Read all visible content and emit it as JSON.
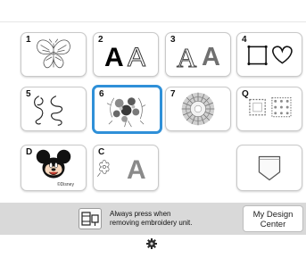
{
  "tiles": [
    {
      "id": "1",
      "label": "1",
      "kind": "butterfly"
    },
    {
      "id": "2",
      "label": "2",
      "kind": "font-aa"
    },
    {
      "id": "3",
      "label": "3",
      "kind": "font-aa-outline"
    },
    {
      "id": "4",
      "label": "4",
      "kind": "frame-heart"
    },
    {
      "id": "5",
      "label": "5",
      "kind": "scroll-flourish"
    },
    {
      "id": "6",
      "label": "6",
      "kind": "flower-bouquet",
      "selected": true
    },
    {
      "id": "7",
      "label": "7",
      "kind": "circle-pattern"
    },
    {
      "id": "Q",
      "label": "Q",
      "kind": "quilt-frames"
    },
    {
      "id": "D",
      "label": "D",
      "kind": "mickey-disney"
    },
    {
      "id": "C",
      "label": "C",
      "kind": "couching-letter"
    },
    {
      "id": "pocket",
      "label": "",
      "kind": "pocket"
    }
  ],
  "tile_text": {
    "font_a": "A",
    "disney_credit": "©Disney"
  },
  "footer": {
    "message": "Always press when\nremoving embroidery unit.",
    "my_design_center": "My Design\nCenter"
  },
  "colors": {
    "selected_border": "#2f90d8",
    "bar_background": "#d9d9d9"
  },
  "icons": {
    "unit": "embroidery-unit-icon",
    "settings": "gear-icon"
  }
}
